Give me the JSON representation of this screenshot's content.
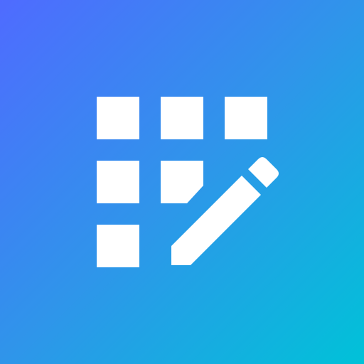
{
  "app_icon": {
    "icon_name": "grid-edit-icon",
    "colors": {
      "gradient_start": "#4f6bff",
      "gradient_mid": "#2f95ea",
      "gradient_end": "#00c2d8",
      "glyph": "#ffffff"
    }
  }
}
